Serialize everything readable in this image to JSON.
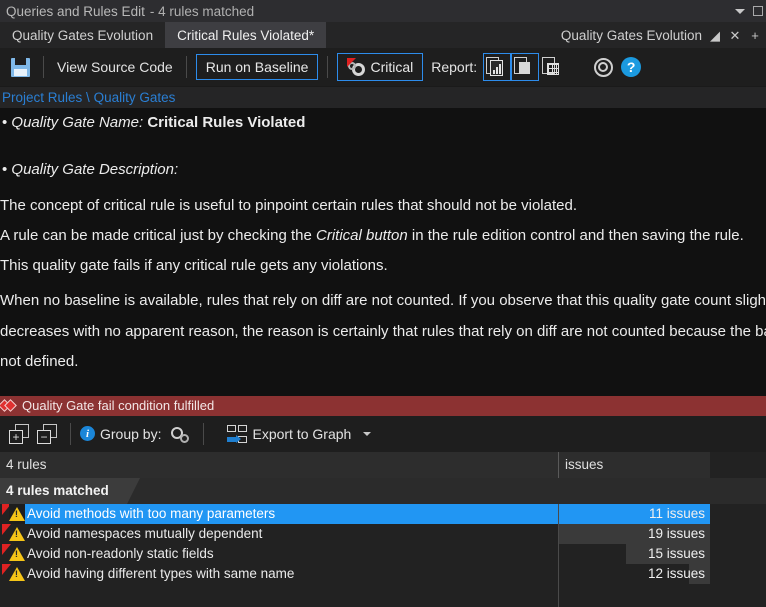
{
  "titlebar": {
    "title": "Queries and Rules Edit",
    "subtitle": "- 4 rules matched",
    "chevron_icon": "chevron-down-icon",
    "maximize_icon": "maximize-icon"
  },
  "tabs": [
    {
      "label": "Quality Gates Evolution",
      "active": false
    },
    {
      "label": "Critical Rules Violated*",
      "active": true
    }
  ],
  "document_header": {
    "title": "Quality Gates Evolution",
    "pin_icon": "pin-icon",
    "close_icon": "close-icon",
    "new_tab_icon": "plus-icon"
  },
  "toolbar": {
    "save_icon": "save-icon",
    "view_source_code": "View Source Code",
    "run_on_baseline": "Run on Baseline",
    "critical_label": "Critical",
    "critical_icon": "gear-critical-icon",
    "report_label": "Report:",
    "report_buttons": [
      {
        "name": "report-chart-icon",
        "active": true
      },
      {
        "name": "report-copy-icon",
        "active": true
      },
      {
        "name": "report-table-icon",
        "active": false
      }
    ],
    "settings_icon": "gear-icon",
    "help_icon": "help-icon"
  },
  "breadcrumb": {
    "root": "Project Rules",
    "separator": " \\ ",
    "current": "Quality Gates"
  },
  "description": {
    "name_bullet": "• ",
    "name_label": "Quality Gate Name:",
    "name_value": "Critical Rules Violated",
    "desc_bullet": "• ",
    "desc_label": "Quality Gate Description:",
    "line1": "The concept of critical rule is useful to pinpoint certain rules that should not be violated.",
    "line2_pre": "A rule can be made critical just by checking the ",
    "line2_em": "Critical button",
    "line2_post": " in the rule edition control and then saving the rule.",
    "line3": "This quality gate fails if any critical rule gets any violations.",
    "line4": "When no baseline is available, rules that rely on diff are not counted. If you observe that this quality gate count slightly",
    "line5": "decreases with no apparent reason, the reason is certainly that rules that rely on diff are not counted because the basel",
    "line6": "not defined."
  },
  "fail_bar": {
    "icon": "fail-diamond-icon",
    "text": "Quality Gate fail condition fulfilled",
    "color": "#8c3232"
  },
  "toolbar2": {
    "expand_all_icon": "expand-all-icon",
    "expand_all_glyph": "+",
    "collapse_all_icon": "collapse-all-icon",
    "collapse_all_glyph": "−",
    "info_icon": "info-icon",
    "info_glyph": "i",
    "group_by_label": "Group by:",
    "group_by_icon": "group-by-gear-icon",
    "export_icon": "export-graph-icon",
    "export_label": "Export to Graph",
    "export_caret": "chevron-down-icon"
  },
  "grid": {
    "columns": [
      {
        "header": "4 rules"
      },
      {
        "header": "issues"
      }
    ],
    "group_header": "4 rules matched",
    "rows": [
      {
        "name": "Avoid methods with too many parameters",
        "value": "11 issues",
        "bar_pct": 72,
        "selected": true,
        "icon": "warning-icon"
      },
      {
        "name": "Avoid namespaces mutually dependent",
        "value": "19 issues",
        "bar_pct": 100,
        "selected": false,
        "icon": "warning-icon"
      },
      {
        "name": "Avoid non-readonly static fields",
        "value": "15 issues",
        "bar_pct": 55,
        "selected": false,
        "icon": "warning-icon"
      },
      {
        "name": "Avoid having different types with same name",
        "value": "12 issues",
        "bar_pct": 14,
        "selected": false,
        "icon": "warning-icon"
      }
    ]
  },
  "colors": {
    "accent_blue": "#2196f3",
    "border_blue": "#2d8ceb",
    "link_blue": "#2a7fd4",
    "fail_red": "#8c3232",
    "warn_yellow": "#f5c518",
    "marker_red": "#e02222"
  }
}
